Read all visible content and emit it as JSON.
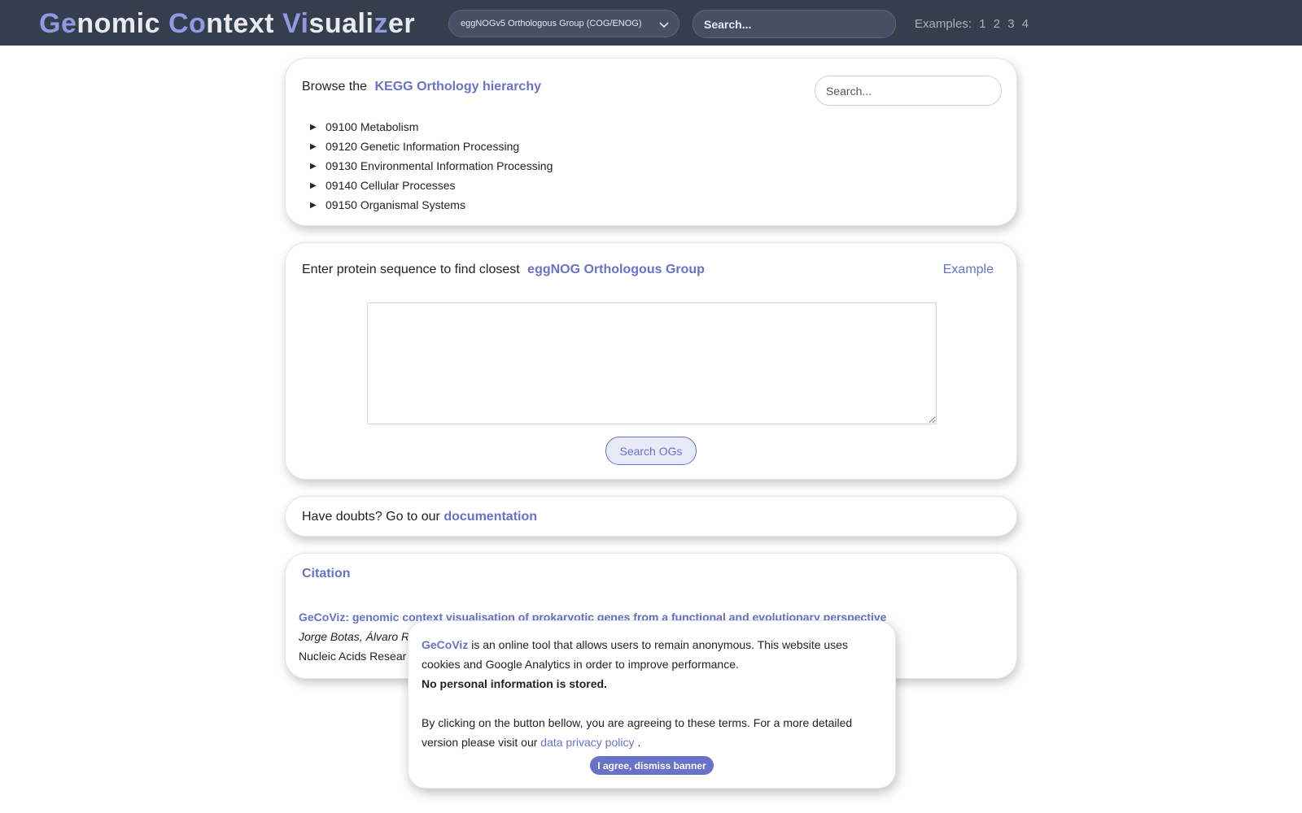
{
  "app": {
    "logo": {
      "segments": [
        {
          "text": "Ge",
          "highlight": true
        },
        {
          "text": "nomic ",
          "highlight": false
        },
        {
          "text": "Co",
          "highlight": true
        },
        {
          "text": "ntext ",
          "highlight": false
        },
        {
          "text": "Vi",
          "highlight": true
        },
        {
          "text": "suali",
          "highlight": false
        },
        {
          "text": "z",
          "highlight": true
        },
        {
          "text": "er",
          "highlight": false
        }
      ]
    }
  },
  "navbar": {
    "db_select": {
      "selected": "eggNOGv5 Orthologous Group (COG/ENOG)",
      "icon": "chevron-down-icon"
    },
    "search": {
      "placeholder": "Search..."
    },
    "examples": {
      "label": "Examples:",
      "items": [
        "1",
        "2",
        "3",
        "4"
      ]
    }
  },
  "kegg": {
    "prefix": "Browse the",
    "link": "KEGG Orthology hierarchy",
    "search_placeholder": "Search...",
    "items": [
      "09100 Metabolism",
      "09120 Genetic Information Processing",
      "09130 Environmental Information Processing",
      "09140 Cellular Processes",
      "09150 Organismal Systems"
    ],
    "tree_icon": "caret-right-icon"
  },
  "sequence": {
    "prefix": "Enter protein sequence to find closest",
    "link": "eggNOG Orthologous Group",
    "example": "Example",
    "textarea_value": "",
    "button": "Search OGs"
  },
  "docs": {
    "prefix": "Have doubts? Go to our",
    "link": "documentation"
  },
  "citation": {
    "title": "Citation",
    "paper_title": "GeCoViz: genomic context visualisation of prokaryotic genes from a functional and evolutionary perspective",
    "authors": "Jorge Botas, Álvaro R",
    "journal": "Nucleic Acids Resear"
  },
  "banner": {
    "brand": "GeCoViz",
    "line1": "is an online tool that allows users to remain anonymous. This website uses cookies and Google Analytics in order to improve performance.",
    "strong": "No personal information is stored.",
    "line2": "By clicking on the button bellow, you are agreeing to these terms. For a more detailed version please visit our",
    "policy_link": "data privacy policy",
    "period": ".",
    "button": "I agree, dismiss banner"
  },
  "colors": {
    "navbar_bg": "#353e4d",
    "accent": "#6872c9",
    "logo_highlight": "#8f9ae3"
  }
}
